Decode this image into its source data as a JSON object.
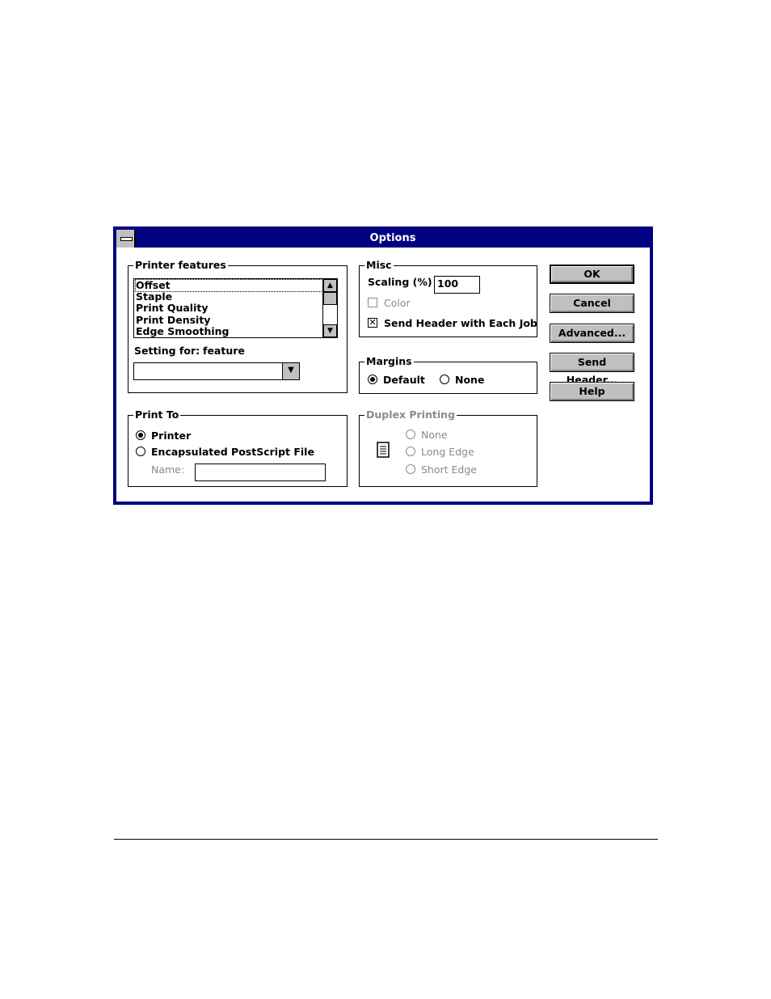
{
  "window": {
    "title": "Options"
  },
  "printer_features": {
    "label": "Printer features",
    "items": [
      "Offset",
      "Staple",
      "Print Quality",
      "Print Density",
      "Edge Smoothing"
    ],
    "selected": "Offset",
    "setting_for_label": "Setting for:",
    "setting_for_value": "feature",
    "combo_value": ""
  },
  "misc": {
    "label": "Misc",
    "scaling_label": "Scaling (%)",
    "scaling_value": "100",
    "color_label": "Color",
    "color_checked": false,
    "send_header_label": "Send Header with Each Job",
    "send_header_checked": true
  },
  "margins": {
    "label": "Margins",
    "options": [
      "Default",
      "None"
    ],
    "selected": "Default"
  },
  "print_to": {
    "label": "Print To",
    "options": [
      "Printer",
      "Encapsulated PostScript File"
    ],
    "selected": "Printer",
    "name_label": "Name:",
    "name_value": ""
  },
  "duplex": {
    "label": "Duplex Printing",
    "options": [
      "None",
      "Long Edge",
      "Short Edge"
    ],
    "enabled": false,
    "icon": "page-icon"
  },
  "buttons": {
    "ok": "OK",
    "cancel": "Cancel",
    "advanced": "Advanced...",
    "send_header": "Send Header...",
    "help": "Help"
  }
}
